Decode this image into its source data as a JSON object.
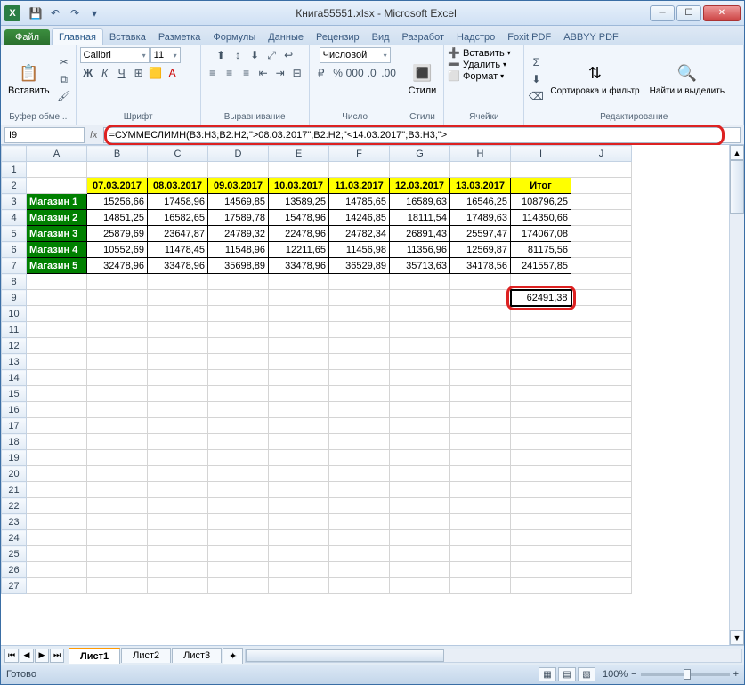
{
  "window": {
    "title": "Книга55551.xlsx - Microsoft Excel"
  },
  "qat": {
    "save": "💾",
    "undo": "↶",
    "redo": "↷"
  },
  "tabs": {
    "file": "Файл",
    "items": [
      "Главная",
      "Вставка",
      "Разметка",
      "Формулы",
      "Данные",
      "Рецензир",
      "Вид",
      "Разработ",
      "Надстро",
      "Foxit PDF",
      "ABBYY PDF"
    ],
    "active": 0
  },
  "ribbon": {
    "clipboard": {
      "label": "Буфер обме...",
      "paste": "Вставить"
    },
    "font": {
      "label": "Шрифт",
      "name": "Calibri",
      "size": "11"
    },
    "alignment": {
      "label": "Выравнивание"
    },
    "number": {
      "label": "Число",
      "format": "Числовой"
    },
    "styles": {
      "label": "Стили",
      "btn": "Стили"
    },
    "cells": {
      "label": "Ячейки",
      "insert": "Вставить",
      "delete": "Удалить",
      "format": "Формат"
    },
    "editing": {
      "label": "Редактирование",
      "sort": "Сортировка и фильтр",
      "find": "Найти и выделить"
    }
  },
  "namebox": "I9",
  "formula": "=СУММЕСЛИМН(B3:H3;B2:H2;\">08.03.2017\";B2:H2;\"<14.03.2017\";B3:H3;\">",
  "columns": [
    "A",
    "B",
    "C",
    "D",
    "E",
    "F",
    "G",
    "H",
    "I",
    "J"
  ],
  "header_row": [
    "",
    "07.03.2017",
    "08.03.2017",
    "09.03.2017",
    "10.03.2017",
    "11.03.2017",
    "12.03.2017",
    "13.03.2017",
    "Итог"
  ],
  "data_rows": [
    {
      "label": "Магазин 1",
      "vals": [
        "15256,66",
        "17458,96",
        "14569,85",
        "13589,25",
        "14785,65",
        "16589,63",
        "16546,25",
        "108796,25"
      ]
    },
    {
      "label": "Магазин 2",
      "vals": [
        "14851,25",
        "16582,65",
        "17589,78",
        "15478,96",
        "14246,85",
        "18111,54",
        "17489,63",
        "114350,66"
      ]
    },
    {
      "label": "Магазин 3",
      "vals": [
        "25879,69",
        "23647,87",
        "24789,32",
        "22478,96",
        "24782,34",
        "26891,43",
        "25597,47",
        "174067,08"
      ]
    },
    {
      "label": "Магазин 4",
      "vals": [
        "10552,69",
        "11478,45",
        "11548,96",
        "12211,65",
        "11456,98",
        "11356,96",
        "12569,87",
        "81175,56"
      ]
    },
    {
      "label": "Магазин 5",
      "vals": [
        "32478,96",
        "33478,96",
        "35698,89",
        "33478,96",
        "36529,89",
        "35713,63",
        "34178,56",
        "241557,85"
      ]
    }
  ],
  "result_cell": "62491,38",
  "sheets": {
    "items": [
      "Лист1",
      "Лист2",
      "Лист3"
    ],
    "active": 0
  },
  "status": {
    "ready": "Готово",
    "zoom": "100%"
  }
}
